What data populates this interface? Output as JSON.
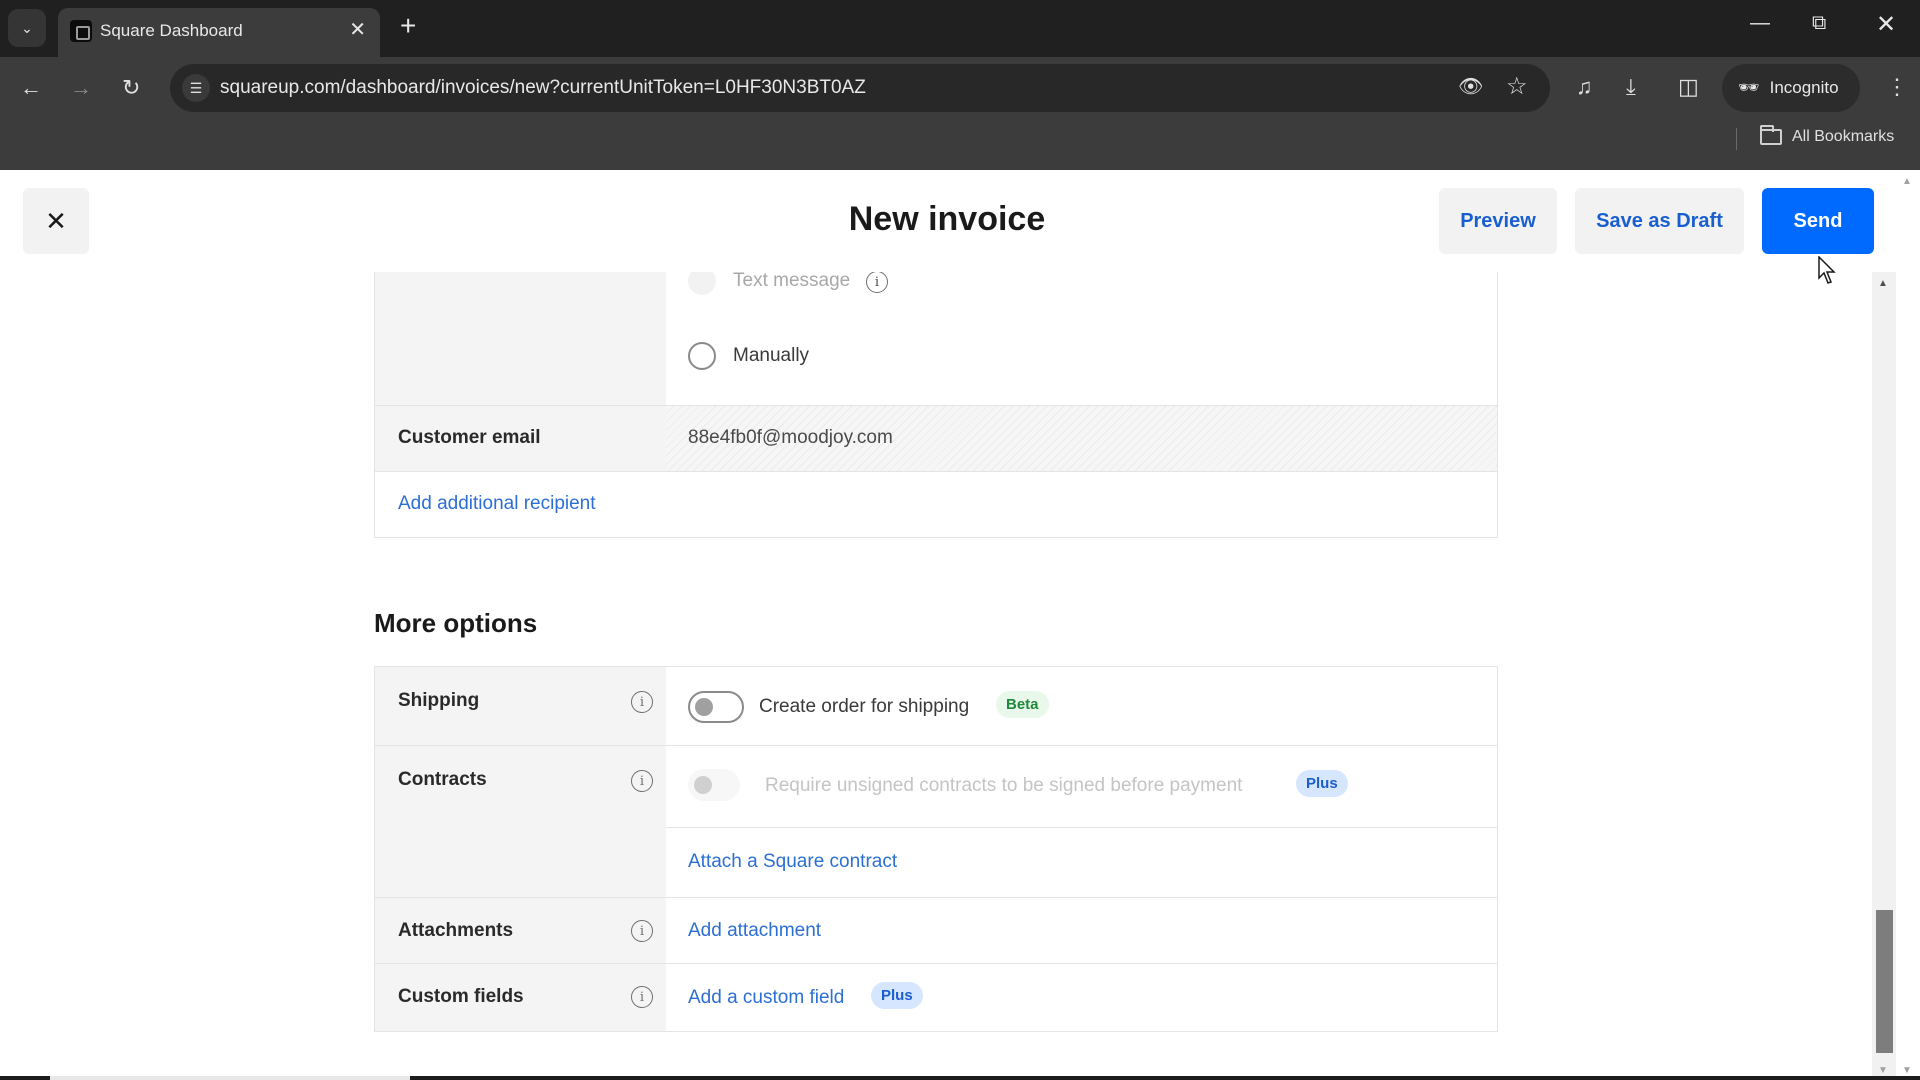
{
  "browser": {
    "tab_title": "Square Dashboard",
    "url": "squareup.com/dashboard/invoices/new?currentUnitToken=L0HF30N3BT0AZ",
    "incognito_label": "Incognito",
    "bookmarks_label": "All Bookmarks"
  },
  "header": {
    "title": "New invoice",
    "preview_label": "Preview",
    "save_draft_label": "Save as Draft",
    "send_label": "Send",
    "accent_color": "#006aff"
  },
  "delivery": {
    "options": [
      {
        "label": "Text message",
        "disabled": true,
        "has_info": true
      },
      {
        "label": "Manually",
        "selected": false
      }
    ]
  },
  "customer_email": {
    "label": "Customer email",
    "value": "88e4fb0f@moodjoy.com"
  },
  "add_recipient_label": "Add additional recipient",
  "more_options": {
    "heading": "More options",
    "rows": {
      "shipping": {
        "label": "Shipping",
        "toggle_label": "Create order for shipping",
        "toggle_on": false,
        "badge": "Beta"
      },
      "contracts": {
        "label": "Contracts",
        "toggle_label": "Require unsigned contracts to be signed before payment",
        "toggle_disabled": true,
        "badge": "Plus",
        "link": "Attach a Square contract"
      },
      "attachments": {
        "label": "Attachments",
        "link": "Add attachment"
      },
      "custom_fields": {
        "label": "Custom fields",
        "link": "Add a custom field",
        "badge": "Plus"
      }
    }
  }
}
